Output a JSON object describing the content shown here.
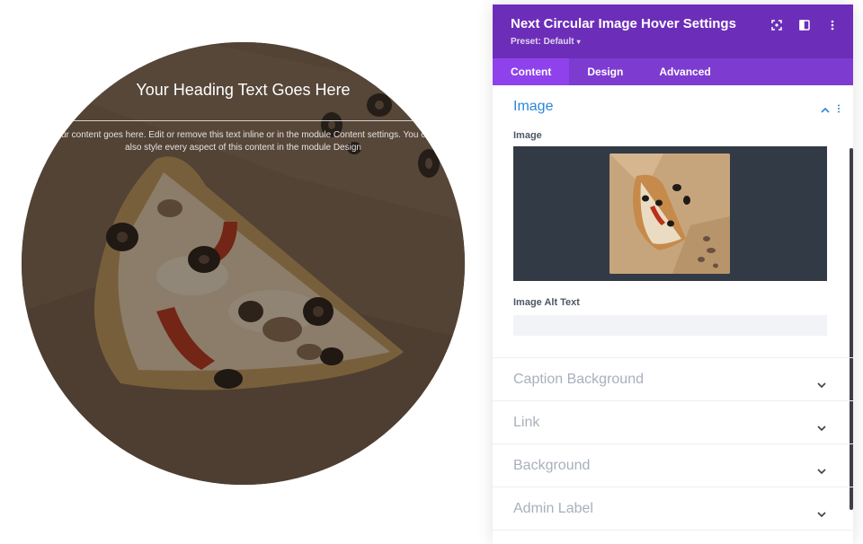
{
  "preview": {
    "heading": "Your Heading Text Goes Here",
    "body_line1": "Your content goes here. Edit or remove this text inline or in the module Content settings. You can",
    "body_line2": "also style every aspect of this content in the module Design"
  },
  "panel": {
    "title": "Next Circular Image Hover Settings",
    "preset": "Preset: Default",
    "header_icons": [
      "focus-icon",
      "split-view-icon",
      "more-vertical-icon"
    ],
    "tabs": [
      {
        "label": "Content",
        "active": true
      },
      {
        "label": "Design",
        "active": false
      },
      {
        "label": "Advanced",
        "active": false
      }
    ],
    "image_section": {
      "title": "Image",
      "image_label": "Image",
      "alt_label": "Image Alt Text",
      "alt_value": "",
      "alt_placeholder": ""
    },
    "sections": [
      {
        "title": "Caption Background"
      },
      {
        "title": "Link"
      },
      {
        "title": "Background"
      },
      {
        "title": "Admin Label"
      }
    ]
  },
  "colors": {
    "header": "#6c2eb9",
    "tabs": "#7e3bd0",
    "active_tab": "#8f42ec",
    "accent_blue": "#2b87da",
    "image_box": "#323a45"
  }
}
